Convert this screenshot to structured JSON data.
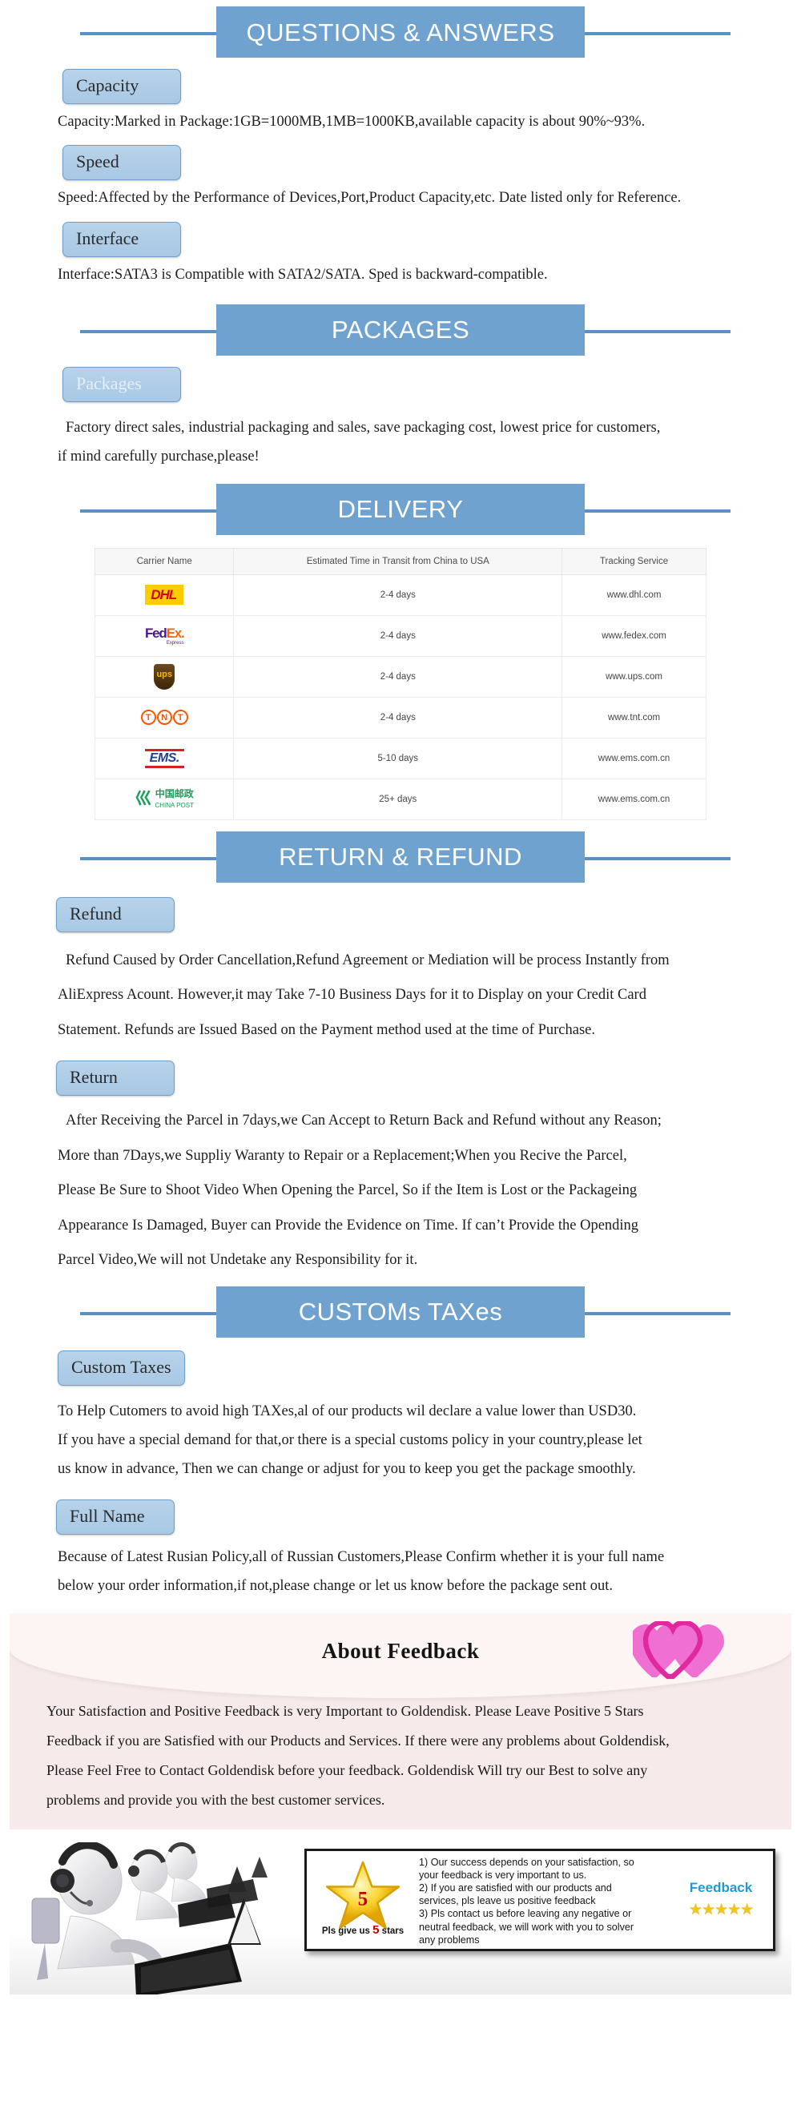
{
  "sections": {
    "qa": {
      "banner": "QUESTIONS & ANSWERS",
      "items": [
        {
          "label": "Capacity",
          "text": "Capacity:Marked in Package:1GB=1000MB,1MB=1000KB,available capacity is about 90%~93%."
        },
        {
          "label": "Speed",
          "text": "Speed:Affected by the Performance of Devices,Port,Product Capacity,etc. Date listed only for Reference."
        },
        {
          "label": "Interface",
          "text": "Interface:SATA3 is Compatible with SATA2/SATA. Sped is backward-compatible."
        }
      ]
    },
    "packages": {
      "banner": "PACKAGES",
      "label": "Packages",
      "line1": "Factory direct sales, industrial packaging and sales, save packaging cost, lowest price for customers,",
      "line2": "if mind carefully purchase,please!"
    },
    "delivery": {
      "banner": "DELIVERY",
      "table": {
        "headers": [
          "Carrier Name",
          "Estimated Time in Transit from China to USA",
          "Tracking Service"
        ],
        "rows": [
          {
            "carrier": "DHL",
            "time": "2-4 days",
            "tracking": "www.dhl.com"
          },
          {
            "carrier": "FedEx",
            "time": "2-4 days",
            "tracking": "www.fedex.com"
          },
          {
            "carrier": "UPS",
            "time": "2-4 days",
            "tracking": "www.ups.com"
          },
          {
            "carrier": "TNT",
            "time": "2-4 days",
            "tracking": "www.tnt.com"
          },
          {
            "carrier": "EMS",
            "time": "5-10 days",
            "tracking": "www.ems.com.cn"
          },
          {
            "carrier": "CHINA POST",
            "time": "25+ days",
            "tracking": "www.ems.com.cn"
          }
        ],
        "logos": {
          "dhl": "DHL",
          "fedex_fed": "Fed",
          "fedex_ex": "Ex.",
          "fedex_sub": "Express",
          "ups": "ups",
          "tnt_t1": "T",
          "tnt_n": "N",
          "tnt_t2": "T",
          "ems": "EMS.",
          "chinapost_cn": "中国邮政",
          "chinapost_en": "CHINA POST"
        }
      }
    },
    "return_refund": {
      "banner": "RETURN & REFUND",
      "refund_label": "Refund",
      "refund_lines": [
        "Refund Caused by Order Cancellation,Refund Agreement or Mediation will be process Instantly from",
        "AliExpress Acount. However,it may Take 7-10 Business Days for it to Display on your Credit Card",
        "Statement. Refunds are Issued Based on the Payment method used at the time of Purchase."
      ],
      "return_label": "Return",
      "return_lines": [
        "After Receiving the Parcel in 7days,we Can Accept to Return Back and Refund without any Reason;",
        "More than 7Days,we Suppliy Waranty to Repair or a Replacement;When you Recive the Parcel,",
        "Please Be Sure to Shoot Video When Opening  the Parcel, So if the Item is Lost or the Packageing",
        "Appearance Is Damaged, Buyer can Provide the Evidence on Time. If can’t Provide the Opending",
        "Parcel Video,We will not Undetake any Responsibility for it."
      ]
    },
    "customs": {
      "banner": "CUSTOMs TAXes",
      "tax_label": "Custom Taxes",
      "tax_lines": [
        "To Help Cutomers to avoid high TAXes,al of our products wil declare a value lower than USD30.",
        "If you have a special demand for that,or there is a special customs policy in your country,please let",
        "us know in advance, Then we can change or adjust for you to keep you get the package smoothly."
      ],
      "fullname_label": "Full Name",
      "fullname_lines": [
        "Because of Latest Rusian Policy,all of Russian Customers,Please Confirm whether it is your full name",
        "below your order information,if not,please change or let us know before the package sent out."
      ]
    },
    "feedback": {
      "title": "About Feedback",
      "lines": [
        "Your Satisfaction and Positive Feedback is very Important to Goldendisk. Please Leave Positive 5 Stars",
        "Feedback if you are Satisfied with our Products and Services. If there were any problems about Goldendisk,",
        "Please Feel Free to Contact Goldendisk before your feedback. Goldendisk Will try our Best to solve any",
        "problems and provide you with the best customer services."
      ]
    },
    "service_card": {
      "star_number": "5",
      "caption_pre": "Pls give us",
      "caption_num": "5",
      "caption_post": "stars",
      "points": [
        "1) Our success depends on your satisfaction, so",
        "your feedback is very important to us.",
        "2) If you are satisfied with our products and",
        "services, pls leave us positive feedback",
        "3) Pls contact us before leaving any negative or",
        "neutral feedback, we will work with you to solver",
        "any problems"
      ],
      "rating_label": "Feedback",
      "stars": "★★★★★"
    }
  },
  "colors": {
    "banner_blue": "#6fa2ce",
    "rule_blue": "#5b90c4",
    "pill_blue": "#b8d3ea",
    "feedback_pink": "#f6eaea",
    "heart_pink": "#f06fd0",
    "star_yellow": "#f5c518",
    "feedback_cyan": "#1f9bd4"
  }
}
